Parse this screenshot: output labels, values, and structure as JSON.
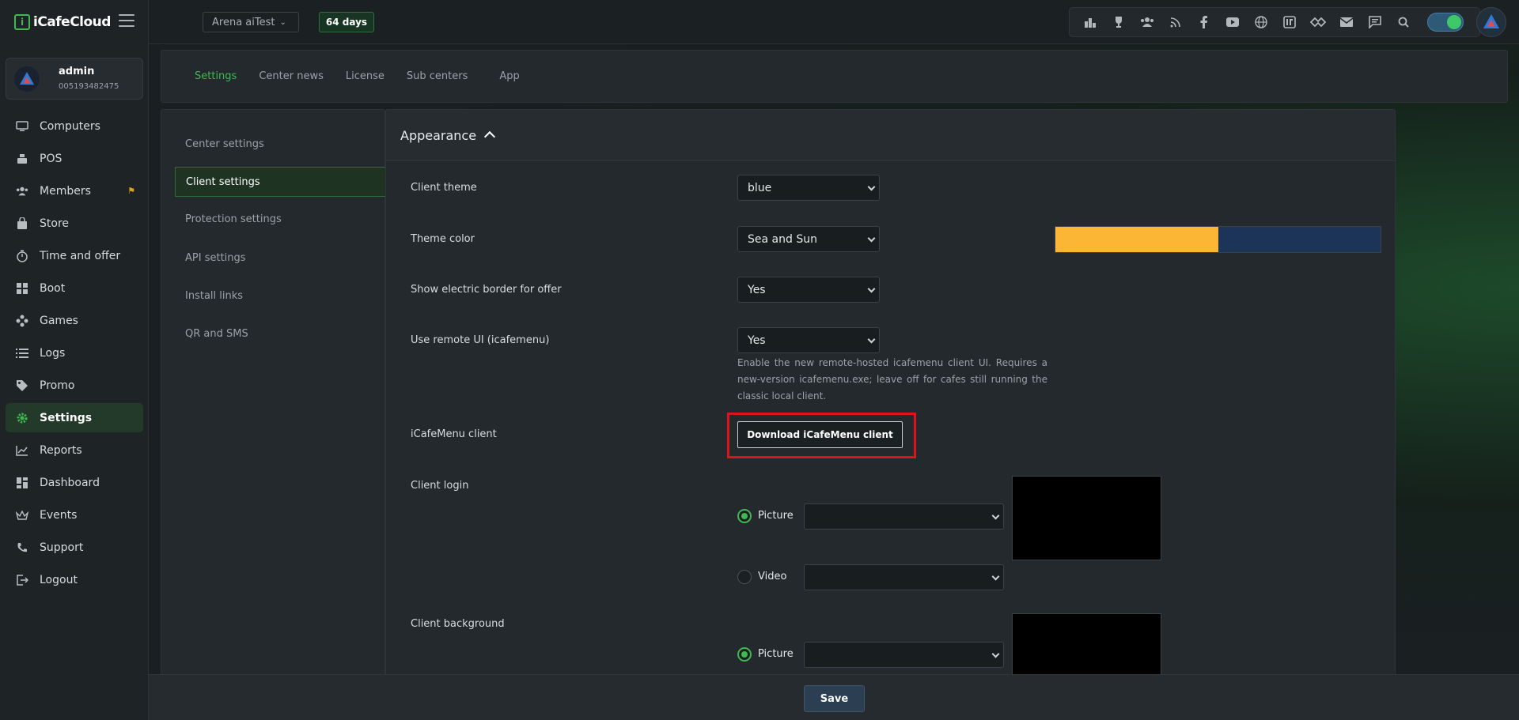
{
  "app": {
    "logo_text": "iCafeCloud"
  },
  "user": {
    "name": "admin",
    "id": "005193482475"
  },
  "sidebar": {
    "items": [
      {
        "label": "Computers",
        "icon": "monitor-icon"
      },
      {
        "label": "POS",
        "icon": "cash-register-icon"
      },
      {
        "label": "Members",
        "icon": "users-icon"
      },
      {
        "label": "Store",
        "icon": "shopping-bag-icon"
      },
      {
        "label": "Time and offer",
        "icon": "stopwatch-icon"
      },
      {
        "label": "Boot",
        "icon": "windows-icon"
      },
      {
        "label": "Games",
        "icon": "gamepad-icon"
      },
      {
        "label": "Logs",
        "icon": "list-icon"
      },
      {
        "label": "Promo",
        "icon": "tag-icon"
      },
      {
        "label": "Settings",
        "icon": "gear-icon"
      },
      {
        "label": "Reports",
        "icon": "chart-line-icon"
      },
      {
        "label": "Dashboard",
        "icon": "dashboard-icon"
      },
      {
        "label": "Events",
        "icon": "crown-icon"
      },
      {
        "label": "Support",
        "icon": "phone-icon"
      },
      {
        "label": "Logout",
        "icon": "logout-icon"
      }
    ],
    "active": "Settings"
  },
  "topbar": {
    "center_name": "Arena aiTest",
    "days_remaining": "64 days",
    "icons": [
      "leaderboard-icon",
      "trophy-icon",
      "group-icon",
      "rss-icon",
      "facebook-icon",
      "youtube-icon",
      "globe-icon",
      "icafe-icon",
      "handshake-icon",
      "mail-icon",
      "chat-icon",
      "search-icon"
    ]
  },
  "tabs": [
    "Settings",
    "Center news",
    "License",
    "Sub centers",
    "App"
  ],
  "active_tab": "Settings",
  "submenu": [
    "Center settings",
    "Client settings",
    "Protection settings",
    "API settings",
    "Install links",
    "QR and SMS"
  ],
  "active_submenu": "Client settings",
  "panel": {
    "title": "Appearance",
    "client_theme": {
      "label": "Client theme",
      "value": "blue"
    },
    "theme_color": {
      "label": "Theme color",
      "value": "Sea and Sun",
      "swatch": [
        "#fbb635",
        "#1c3458"
      ]
    },
    "electric_border": {
      "label": "Show electric border for offer",
      "value": "Yes"
    },
    "remote_ui": {
      "label": "Use remote UI (icafemenu)",
      "value": "Yes",
      "help": "Enable the new remote-hosted icafemenu client UI. Requires a new-version icafemenu.exe; leave off for cafes still running the classic local client."
    },
    "icafemenu_client": {
      "label": "iCafeMenu client",
      "button": "Download iCafeMenu client"
    },
    "client_login": {
      "label": "Client login",
      "picture_label": "Picture",
      "video_label": "Video",
      "selected": "Picture"
    },
    "client_background": {
      "label": "Client background",
      "picture_label": "Picture",
      "selected": "Picture"
    }
  },
  "footer": {
    "save_label": "Save"
  },
  "colors": {
    "accent": "#3fb950",
    "highlight": "#e0121c"
  }
}
